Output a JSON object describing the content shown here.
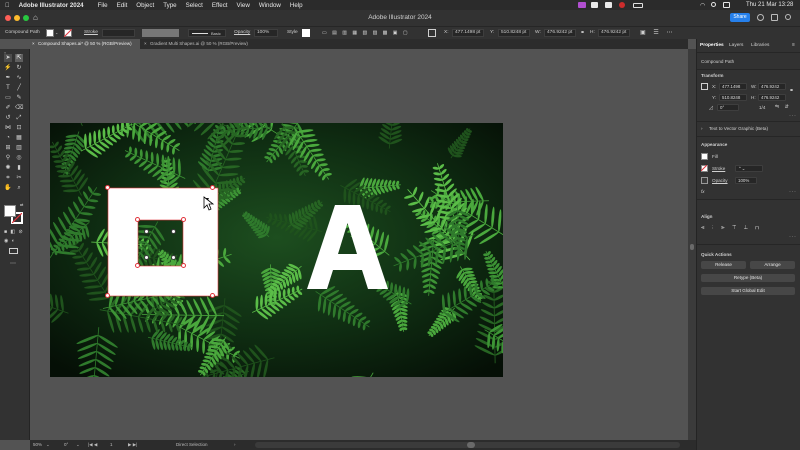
{
  "menubar": {
    "app_name": "Adobe Illustrator 2024",
    "items": [
      "File",
      "Edit",
      "Object",
      "Type",
      "Select",
      "Effect",
      "View",
      "Window",
      "Help"
    ],
    "clock": "Thu 21 Mar  13:28"
  },
  "titlebar": {
    "title": "Adobe Illustrator 2024",
    "share_label": "Share"
  },
  "controlbar": {
    "selection_label": "Compound Path",
    "stroke_label": "Stroke",
    "style_preset": "Basic",
    "opacity_label": "Opacity",
    "opacity_value": "100%",
    "style_label": "Style",
    "x_value": "477.1498 pt",
    "y_value": "510.8248 pt",
    "w_value": "476.9242 pt",
    "h_value": "476.9242 pt"
  },
  "tabs": [
    {
      "label": "Compound Shapes.ai* @ 50 % (RGB/Preview)",
      "active": true
    },
    {
      "label": "Gradient Multi Shapes.ai @ 50 % (RGB/Preview)",
      "active": false
    }
  ],
  "artwork": {
    "letter": "A"
  },
  "panel": {
    "tabs": [
      "Properties",
      "Layers",
      "Libraries"
    ],
    "selection_type": "Compound Path",
    "transform_title": "Transform",
    "x_label": "X:",
    "x_value": "477.1498",
    "y_label": "Y:",
    "y_value": "510.8248",
    "w_label": "W:",
    "w_value": "476.9242",
    "h_label": "H:",
    "h_value": "476.9242",
    "angle_value": "0°",
    "ratio_value": "1/4",
    "text_to_vector_label": "Text to Vector Graphic (Beta)",
    "appearance_title": "Appearance",
    "fill_label": "Fill",
    "stroke_label": "Stroke",
    "opacity_label": "Opacity",
    "opacity_value": "100%",
    "fx_label": "fx",
    "align_title": "Align",
    "quick_actions_title": "Quick Actions",
    "release_label": "Release",
    "arrange_label": "Arrange",
    "retype_label": "Retype (Beta)",
    "global_edit_label": "Start Global Edit"
  },
  "statusbar": {
    "zoom": "50%",
    "rotation": "0°",
    "artboard_number": "1",
    "tool_name": "Direct Selection"
  },
  "colors": {
    "accent": "#2680eb",
    "selection": "#e0353d",
    "artboard_bg": "#0b220d",
    "pasteboard": "#535353"
  }
}
